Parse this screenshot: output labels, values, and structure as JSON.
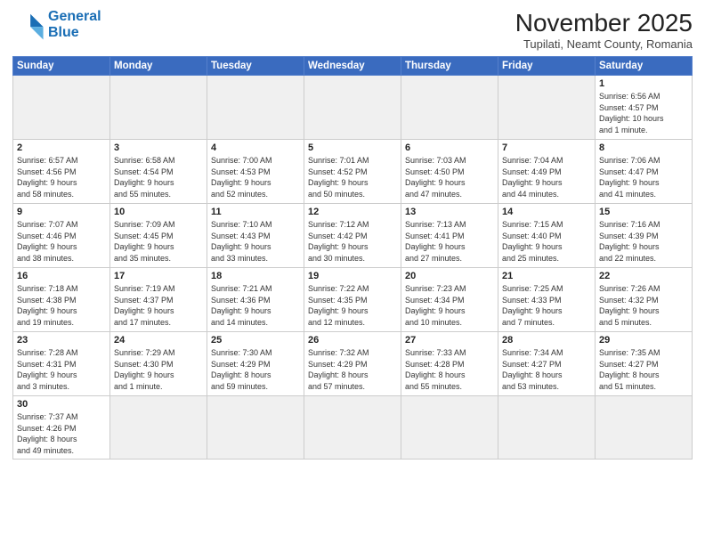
{
  "logo": {
    "line1": "General",
    "line2": "Blue"
  },
  "title": "November 2025",
  "subtitle": "Tupilati, Neamt County, Romania",
  "days_of_week": [
    "Sunday",
    "Monday",
    "Tuesday",
    "Wednesday",
    "Thursday",
    "Friday",
    "Saturday"
  ],
  "weeks": [
    [
      {
        "day": "",
        "info": ""
      },
      {
        "day": "",
        "info": ""
      },
      {
        "day": "",
        "info": ""
      },
      {
        "day": "",
        "info": ""
      },
      {
        "day": "",
        "info": ""
      },
      {
        "day": "",
        "info": ""
      },
      {
        "day": "1",
        "info": "Sunrise: 6:56 AM\nSunset: 4:57 PM\nDaylight: 10 hours\nand 1 minute."
      }
    ],
    [
      {
        "day": "2",
        "info": "Sunrise: 6:57 AM\nSunset: 4:56 PM\nDaylight: 9 hours\nand 58 minutes."
      },
      {
        "day": "3",
        "info": "Sunrise: 6:58 AM\nSunset: 4:54 PM\nDaylight: 9 hours\nand 55 minutes."
      },
      {
        "day": "4",
        "info": "Sunrise: 7:00 AM\nSunset: 4:53 PM\nDaylight: 9 hours\nand 52 minutes."
      },
      {
        "day": "5",
        "info": "Sunrise: 7:01 AM\nSunset: 4:52 PM\nDaylight: 9 hours\nand 50 minutes."
      },
      {
        "day": "6",
        "info": "Sunrise: 7:03 AM\nSunset: 4:50 PM\nDaylight: 9 hours\nand 47 minutes."
      },
      {
        "day": "7",
        "info": "Sunrise: 7:04 AM\nSunset: 4:49 PM\nDaylight: 9 hours\nand 44 minutes."
      },
      {
        "day": "8",
        "info": "Sunrise: 7:06 AM\nSunset: 4:47 PM\nDaylight: 9 hours\nand 41 minutes."
      }
    ],
    [
      {
        "day": "9",
        "info": "Sunrise: 7:07 AM\nSunset: 4:46 PM\nDaylight: 9 hours\nand 38 minutes."
      },
      {
        "day": "10",
        "info": "Sunrise: 7:09 AM\nSunset: 4:45 PM\nDaylight: 9 hours\nand 35 minutes."
      },
      {
        "day": "11",
        "info": "Sunrise: 7:10 AM\nSunset: 4:43 PM\nDaylight: 9 hours\nand 33 minutes."
      },
      {
        "day": "12",
        "info": "Sunrise: 7:12 AM\nSunset: 4:42 PM\nDaylight: 9 hours\nand 30 minutes."
      },
      {
        "day": "13",
        "info": "Sunrise: 7:13 AM\nSunset: 4:41 PM\nDaylight: 9 hours\nand 27 minutes."
      },
      {
        "day": "14",
        "info": "Sunrise: 7:15 AM\nSunset: 4:40 PM\nDaylight: 9 hours\nand 25 minutes."
      },
      {
        "day": "15",
        "info": "Sunrise: 7:16 AM\nSunset: 4:39 PM\nDaylight: 9 hours\nand 22 minutes."
      }
    ],
    [
      {
        "day": "16",
        "info": "Sunrise: 7:18 AM\nSunset: 4:38 PM\nDaylight: 9 hours\nand 19 minutes."
      },
      {
        "day": "17",
        "info": "Sunrise: 7:19 AM\nSunset: 4:37 PM\nDaylight: 9 hours\nand 17 minutes."
      },
      {
        "day": "18",
        "info": "Sunrise: 7:21 AM\nSunset: 4:36 PM\nDaylight: 9 hours\nand 14 minutes."
      },
      {
        "day": "19",
        "info": "Sunrise: 7:22 AM\nSunset: 4:35 PM\nDaylight: 9 hours\nand 12 minutes."
      },
      {
        "day": "20",
        "info": "Sunrise: 7:23 AM\nSunset: 4:34 PM\nDaylight: 9 hours\nand 10 minutes."
      },
      {
        "day": "21",
        "info": "Sunrise: 7:25 AM\nSunset: 4:33 PM\nDaylight: 9 hours\nand 7 minutes."
      },
      {
        "day": "22",
        "info": "Sunrise: 7:26 AM\nSunset: 4:32 PM\nDaylight: 9 hours\nand 5 minutes."
      }
    ],
    [
      {
        "day": "23",
        "info": "Sunrise: 7:28 AM\nSunset: 4:31 PM\nDaylight: 9 hours\nand 3 minutes."
      },
      {
        "day": "24",
        "info": "Sunrise: 7:29 AM\nSunset: 4:30 PM\nDaylight: 9 hours\nand 1 minute."
      },
      {
        "day": "25",
        "info": "Sunrise: 7:30 AM\nSunset: 4:29 PM\nDaylight: 8 hours\nand 59 minutes."
      },
      {
        "day": "26",
        "info": "Sunrise: 7:32 AM\nSunset: 4:29 PM\nDaylight: 8 hours\nand 57 minutes."
      },
      {
        "day": "27",
        "info": "Sunrise: 7:33 AM\nSunset: 4:28 PM\nDaylight: 8 hours\nand 55 minutes."
      },
      {
        "day": "28",
        "info": "Sunrise: 7:34 AM\nSunset: 4:27 PM\nDaylight: 8 hours\nand 53 minutes."
      },
      {
        "day": "29",
        "info": "Sunrise: 7:35 AM\nSunset: 4:27 PM\nDaylight: 8 hours\nand 51 minutes."
      }
    ],
    [
      {
        "day": "30",
        "info": "Sunrise: 7:37 AM\nSunset: 4:26 PM\nDaylight: 8 hours\nand 49 minutes."
      },
      {
        "day": "",
        "info": ""
      },
      {
        "day": "",
        "info": ""
      },
      {
        "day": "",
        "info": ""
      },
      {
        "day": "",
        "info": ""
      },
      {
        "day": "",
        "info": ""
      },
      {
        "day": "",
        "info": ""
      }
    ]
  ]
}
